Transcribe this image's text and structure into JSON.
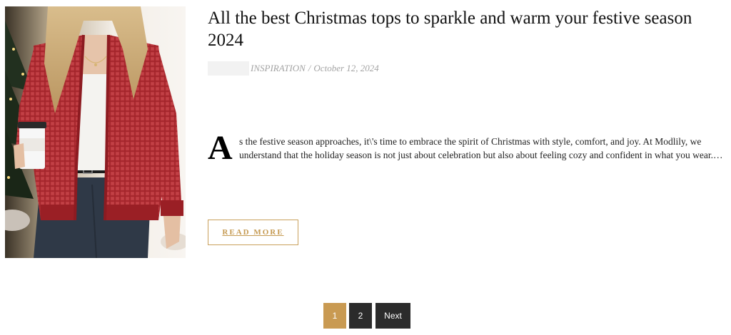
{
  "post": {
    "title": "All the best Christmas tops to sparkle and warm your festive season 2024",
    "category": "INSPIRATION",
    "separator": "/",
    "date": "October 12, 2024",
    "dropcap": "A",
    "excerpt": "s the festive season approaches, it\\'s time to embrace the spirit of Christmas with style, comfort, and joy. At Modlily, we understand that the holiday season is not just about celebration but also about feeling cozy and confident in what you wear.…",
    "read_more_label": "READ MORE"
  },
  "pagination": {
    "pages": [
      "1",
      "2"
    ],
    "current": "1",
    "next_label": "Next"
  },
  "colors": {
    "accent": "#c99a52",
    "dark_button": "#2b2b2b",
    "meta_text": "#a3a3a3"
  }
}
